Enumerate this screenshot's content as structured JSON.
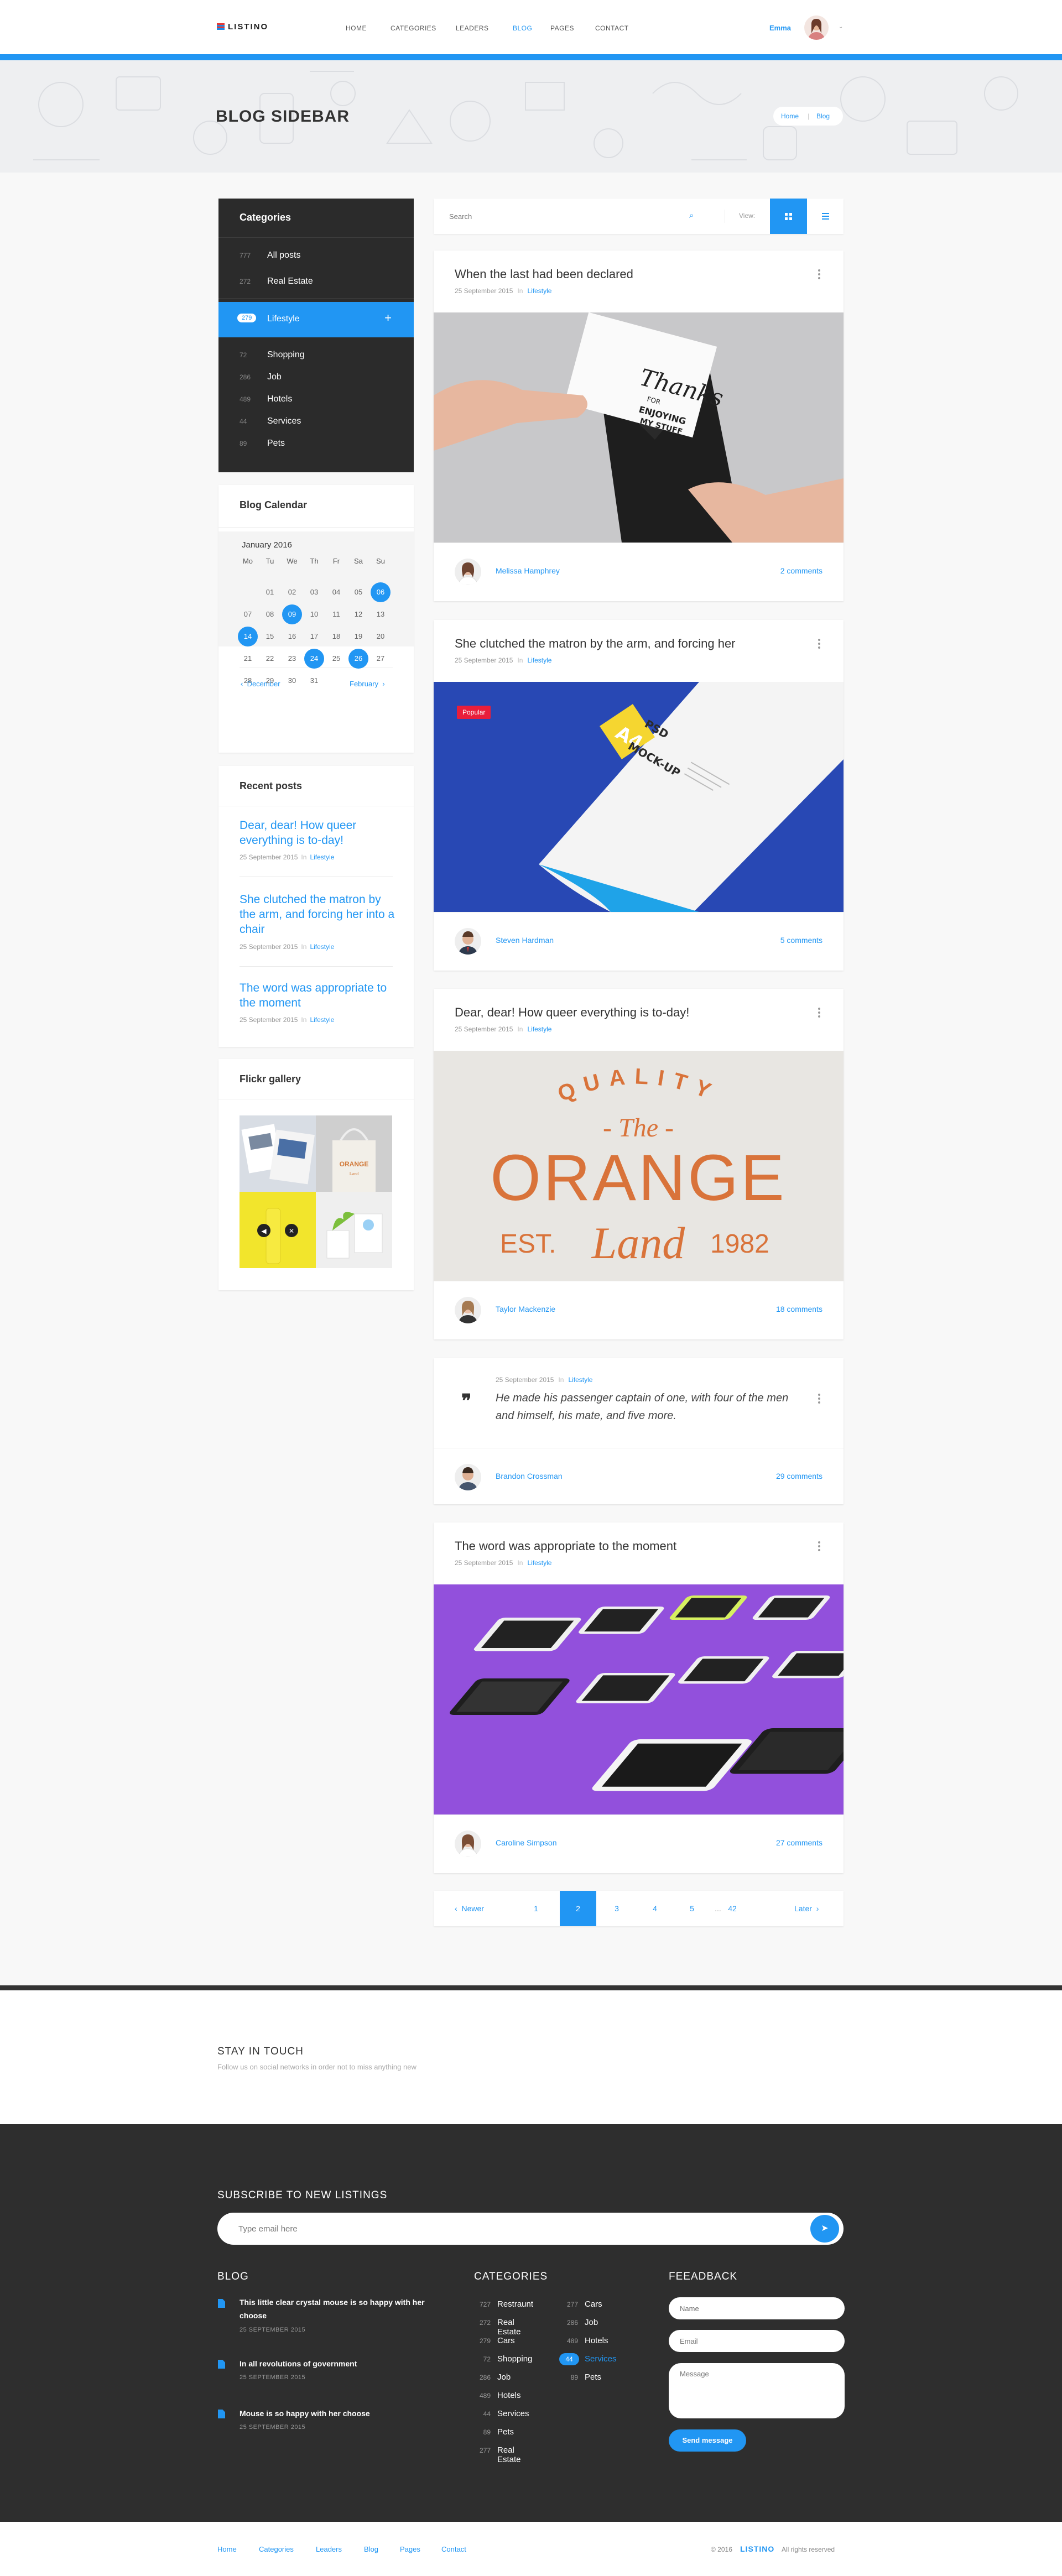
{
  "header": {
    "logo": "LISTINO",
    "nav": [
      "HOME",
      "CATEGORIES",
      "LEADERS",
      "BLOG",
      "PAGES",
      "CONTACT"
    ],
    "active_nav": "BLOG",
    "user_name": "Emma"
  },
  "hero": {
    "title": "BLOG SIDEBAR",
    "breadcrumb": [
      "Home",
      "Blog"
    ]
  },
  "categories_widget": {
    "title": "Categories",
    "items": [
      {
        "count": "777",
        "label": "All posts"
      },
      {
        "count": "272",
        "label": "Real Estate"
      },
      {
        "count": "279",
        "label": "Lifestyle",
        "active": true
      },
      {
        "count": "72",
        "label": "Shopping"
      },
      {
        "count": "286",
        "label": "Job"
      },
      {
        "count": "489",
        "label": "Hotels"
      },
      {
        "count": "44",
        "label": "Services"
      },
      {
        "count": "89",
        "label": "Pets"
      }
    ]
  },
  "calendar_widget": {
    "title": "Blog Calendar",
    "month": "January 2016",
    "days_of_week": [
      "Mo",
      "Tu",
      "We",
      "Th",
      "Fr",
      "Sa",
      "Su"
    ],
    "weeks": [
      [
        "",
        "01",
        "02",
        "03",
        "04",
        "05",
        "06"
      ],
      [
        "07",
        "08",
        "09",
        "10",
        "11",
        "12",
        "13"
      ],
      [
        "14",
        "15",
        "16",
        "17",
        "18",
        "19",
        "20"
      ],
      [
        "21",
        "22",
        "23",
        "24",
        "25",
        "26",
        "27"
      ],
      [
        "28",
        "29",
        "30",
        "31",
        "",
        "",
        ""
      ]
    ],
    "highlighted": [
      "06",
      "09",
      "14",
      "24",
      "26"
    ],
    "prev": "December",
    "next": "February"
  },
  "recent_widget": {
    "title": "Recent posts",
    "posts": [
      {
        "title": "Dear, dear! How queer everything is to-day!",
        "date": "25 September 2015",
        "in": "In",
        "category": "Lifestyle"
      },
      {
        "title": "She clutched the matron by the arm, and forcing her into a chair",
        "date": "25 September 2015",
        "in": "In",
        "category": "Lifestyle"
      },
      {
        "title": "The word was appropriate to the moment",
        "date": "25 September 2015",
        "in": "In",
        "category": "Lifestyle"
      }
    ]
  },
  "flickr_widget": {
    "title": "Flickr gallery"
  },
  "toolbar": {
    "search_placeholder": "Search",
    "view_label": "View:"
  },
  "posts": [
    {
      "title": "When the last had been declared",
      "date": "25 September 2015",
      "in": "In",
      "category": "Lifestyle",
      "author": "Melissa Hamphrey",
      "comments": "2 comments",
      "image_text": [
        "Thanks",
        "FOR",
        "ENJOYING",
        "MY STUFF"
      ]
    },
    {
      "title": "She clutched the matron by the arm, and forcing her",
      "date": "25 September 2015",
      "in": "In",
      "category": "Lifestyle",
      "author": "Steven Hardman",
      "comments": "5 comments",
      "badge": "Popular",
      "image_text": [
        "A4",
        "PSD",
        "MOCK-UP"
      ]
    },
    {
      "title": "Dear, dear! How queer everything is to-day!",
      "date": "25 September 2015",
      "in": "In",
      "category": "Lifestyle",
      "author": "Taylor Mackenzie",
      "comments": "18 comments",
      "image_text": [
        "QUALITY",
        "- The -",
        "ORANGE",
        "EST.",
        "Land",
        "1982"
      ]
    },
    {
      "quote": "He made his passenger captain of one, with four of the men and himself, his mate, and five more.",
      "date": "25 September 2015",
      "in": "In",
      "category": "Lifestyle",
      "author": "Brandon Crossman",
      "comments": "29 comments"
    },
    {
      "title": "The word was appropriate to the moment",
      "date": "25 September 2015",
      "in": "In",
      "category": "Lifestyle",
      "author": "Caroline Simpson",
      "comments": "27 comments"
    }
  ],
  "pagination": {
    "prev": "Newer",
    "pages": [
      "1",
      "2",
      "3",
      "4",
      "5",
      "...",
      "42"
    ],
    "current": "2",
    "next": "Later"
  },
  "social": {
    "title": "STAY IN TOUCH",
    "subtitle": "Follow us on social networks in order not to miss anything new",
    "networks": [
      {
        "name": "twitter-icon",
        "color": "#55acee",
        "glyph": "t"
      },
      {
        "name": "google-plus-icon",
        "color": "#dd4b39",
        "glyph": "G"
      },
      {
        "name": "facebook-icon",
        "color": "#3b5998",
        "glyph": "f"
      },
      {
        "name": "vk-icon",
        "color": "#4c75a3",
        "glyph": "vk"
      },
      {
        "name": "dribbble-icon",
        "color": "#ea4c89",
        "glyph": "◎"
      },
      {
        "name": "pinterest-icon",
        "color": "#cb2027",
        "glyph": "p"
      }
    ]
  },
  "footer": {
    "subscribe_title": "SUBSCRIBE TO NEW LISTINGS",
    "subscribe_placeholder": "Type email here",
    "blog_title": "BLOG",
    "blog_posts": [
      {
        "title": "This little clear crystal mouse is so happy with her choose",
        "date": "25 SEPTEMBER 2015"
      },
      {
        "title": "In all revolutions of government",
        "date": "25 SEPTEMBER 2015"
      },
      {
        "title": "Mouse is so happy with her choose",
        "date": "25 SEPTEMBER 2015"
      }
    ],
    "categories_title": "CATEGORIES",
    "categories_col1": [
      {
        "count": "727",
        "label": "Restraunt"
      },
      {
        "count": "272",
        "label": "Real Estate"
      },
      {
        "count": "279",
        "label": "Cars"
      },
      {
        "count": "72",
        "label": "Shopping"
      },
      {
        "count": "286",
        "label": "Job"
      },
      {
        "count": "489",
        "label": "Hotels"
      },
      {
        "count": "44",
        "label": "Services"
      },
      {
        "count": "89",
        "label": "Pets"
      },
      {
        "count": "277",
        "label": "Real Estate"
      }
    ],
    "categories_col2": [
      {
        "count": "277",
        "label": "Cars"
      },
      {
        "count": "286",
        "label": "Job"
      },
      {
        "count": "489",
        "label": "Hotels"
      },
      {
        "count": "44",
        "label": "Services",
        "active": true
      },
      {
        "count": "89",
        "label": "Pets"
      }
    ],
    "feedback_title": "FEEADBACK",
    "name_placeholder": "Name",
    "email_placeholder": "Email",
    "message_placeholder": "Message",
    "send_label": "Send message"
  },
  "bottom": {
    "links": [
      "Home",
      "Categories",
      "Leaders",
      "Blog",
      "Pages",
      "Contact"
    ],
    "copyright_year": "© 2016",
    "brand": "LISTINO",
    "rights": "All rights reserved"
  },
  "colors": {
    "accent": "#2196f3",
    "dark": "#2b2b2b",
    "footer": "#2e2e2e"
  }
}
